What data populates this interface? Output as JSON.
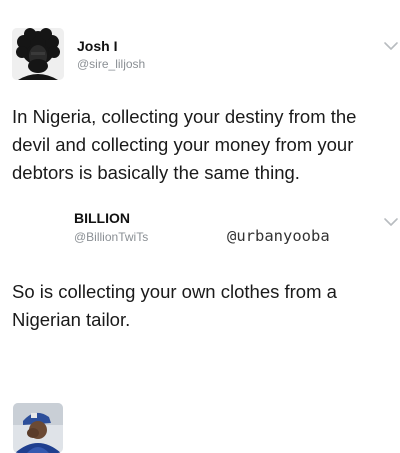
{
  "tweets": [
    {
      "display_name": "Josh I",
      "handle": "@sire_liljosh",
      "avatar_icon": "afro-silhouette-avatar",
      "menu_icon": "chevron-down-icon",
      "text": "In Nigeria, collecting your destiny from the\ndevil and collecting your money from your\ndebtors is basically the same thing."
    },
    {
      "display_name": "BILLION",
      "handle": "@BillionTwiTs",
      "avatar_icon": "person-photo-avatar",
      "menu_icon": "chevron-down-icon",
      "text": "So is collecting your own clothes from a\nNigerian tailor."
    }
  ],
  "watermark": "@urbanyooba",
  "colors": {
    "text": "#1a1a1a",
    "handle": "#8a8f94",
    "chevron": "#b8bcc0",
    "background": "#ffffff"
  }
}
